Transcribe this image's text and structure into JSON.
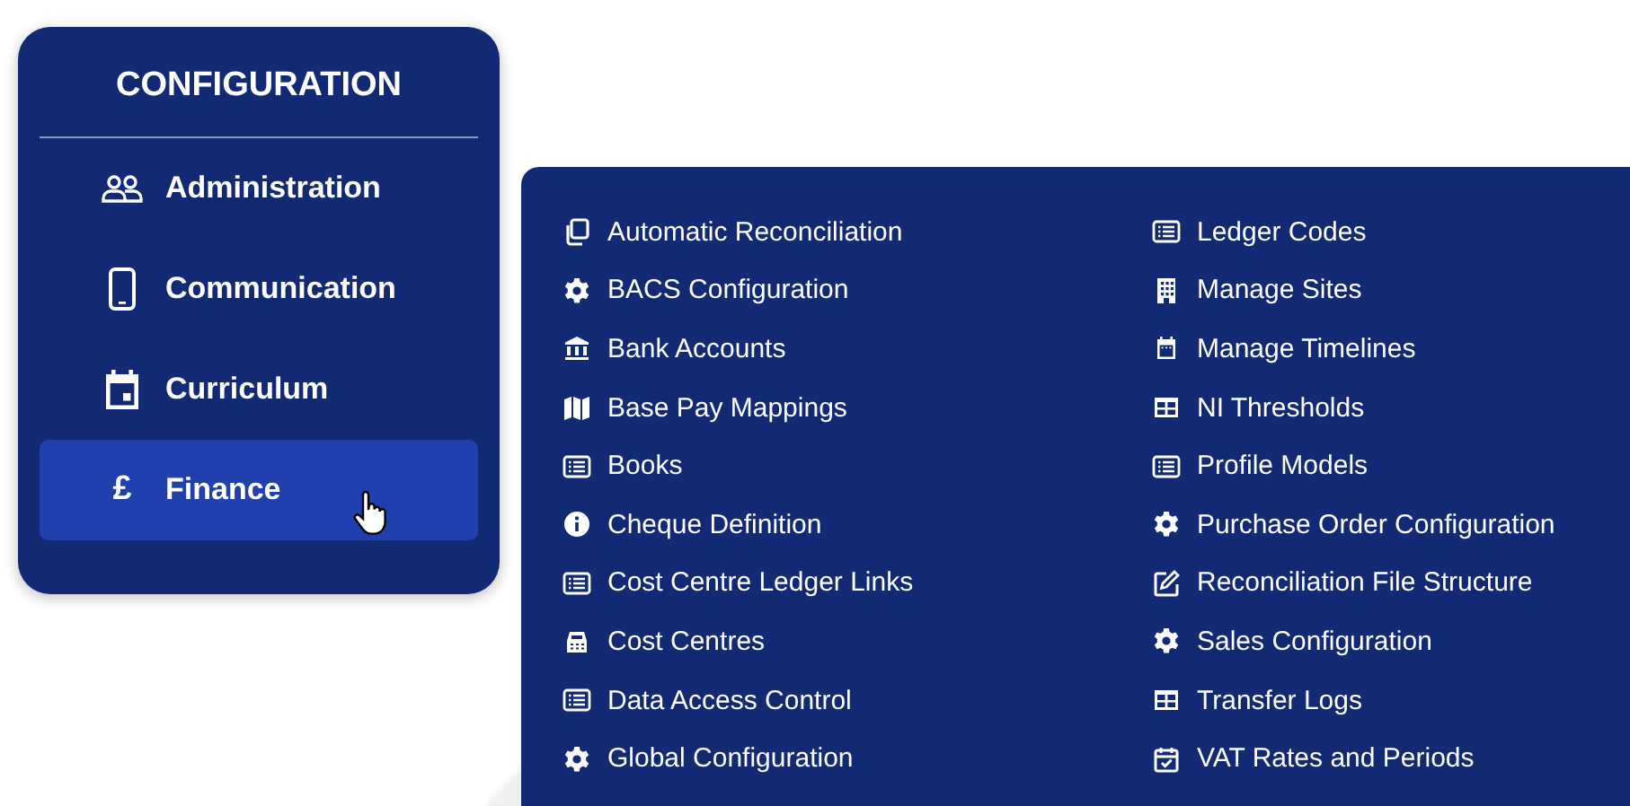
{
  "menu": {
    "title": "CONFIGURATION",
    "items": [
      {
        "label": "Administration",
        "selected": false
      },
      {
        "label": "Communication",
        "selected": false
      },
      {
        "label": "Curriculum",
        "selected": false
      },
      {
        "label": "Finance",
        "symbol": "£",
        "selected": true
      }
    ]
  },
  "submenu": {
    "columns": [
      [
        "Automatic Reconciliation",
        "BACS Configuration",
        "Bank Accounts",
        "Base Pay Mappings",
        "Books",
        "Cheque Definition",
        "Cost Centre Ledger Links",
        "Cost Centres",
        "Data Access Control",
        "Global Configuration"
      ],
      [
        "Ledger Codes",
        "Manage Sites",
        "Manage Timelines",
        "NI Thresholds",
        "Profile Models",
        "Purchase Order Configuration",
        "Reconciliation File Structure",
        "Sales Configuration",
        "Transfer Logs",
        "VAT Rates and Periods"
      ]
    ]
  }
}
